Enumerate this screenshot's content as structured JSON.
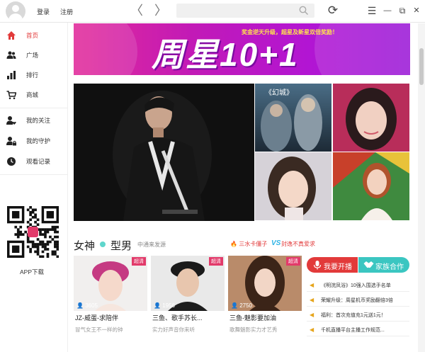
{
  "topbar": {
    "login": "登录",
    "register": "注册",
    "back_glyph": "〈",
    "forward_glyph": "〉",
    "search_placeholder": "",
    "refresh_glyph": "⟳",
    "menu_glyph": "☰",
    "minimize_glyph": "—",
    "restore_glyph": "⧉",
    "close_glyph": "✕"
  },
  "sidebar": {
    "items": [
      {
        "label": "首页",
        "icon": "home-icon",
        "active": true
      },
      {
        "label": "广场",
        "icon": "users-icon",
        "active": false
      },
      {
        "label": "排行",
        "icon": "bar-chart-icon",
        "active": false
      },
      {
        "label": "商城",
        "icon": "cart-icon",
        "active": false
      },
      {
        "label": "我的关注",
        "icon": "user-heart-icon",
        "active": false
      },
      {
        "label": "我的守护",
        "icon": "user-lock-icon",
        "active": false
      },
      {
        "label": "观看记录",
        "icon": "clock-icon",
        "active": false
      }
    ],
    "app_download": "APP下载",
    "accent": "#e23a3a"
  },
  "banner": {
    "title": "周星10+1",
    "subtitle": "奖金逆天升级，超星及新星双倍奖励！"
  },
  "section": {
    "title_a": "女神",
    "title_b": "型男",
    "tag": "中通来发源",
    "ticker": "三水卡僵子",
    "vs": "VS",
    "ticker2": "封逸不真爱求"
  },
  "cards": [
    {
      "badge": "超清",
      "viewers": "3605",
      "name": "JZ-威蛋-求陪伴",
      "desc": "冒气女王不一样的钟"
    },
    {
      "badge": "超清",
      "viewers": "1956",
      "name": "三鱼、歌手苏长...",
      "desc": "实力好声音你来听"
    },
    {
      "badge": "超清",
      "viewers": "2750",
      "name": "三鱼-魅影要加油",
      "desc": "歌舞魅影实力才艺秀"
    }
  ],
  "actions": {
    "go_live": "我要开播",
    "cooperate": "家族合作"
  },
  "news": [
    "《明浣凤浴》10强入围选手名单",
    "荣耀升级：周星机币奖励翻倍3倍",
    "福利：首次充值充1元送1元！",
    "千机直播平台主播工作规范..."
  ],
  "colors": {
    "accent_red": "#e23a3a",
    "accent_teal": "#3bc6c1",
    "banner_magenta": "#c21ab6"
  }
}
